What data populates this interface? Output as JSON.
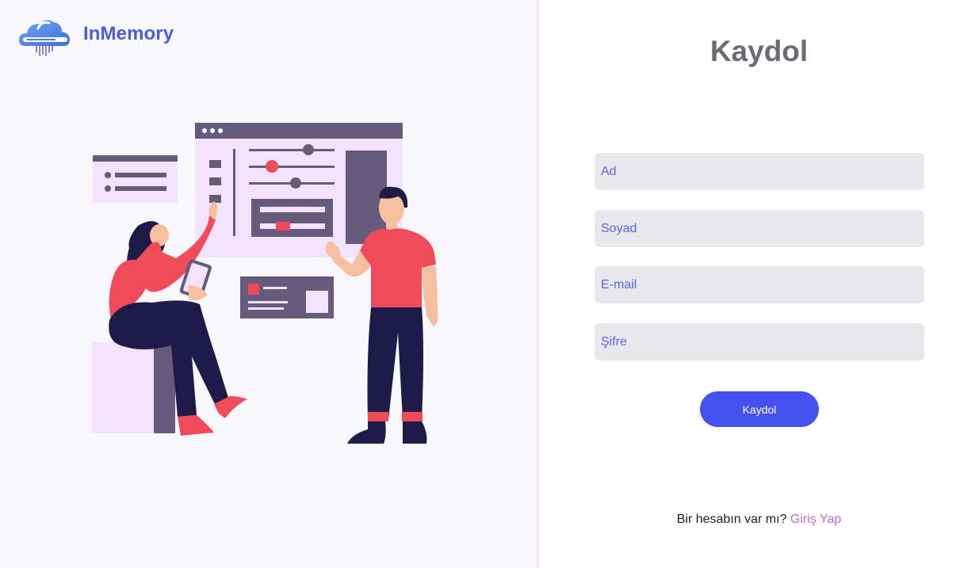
{
  "brand": {
    "name": "InMemory",
    "logo_icon": "cloud-database-icon"
  },
  "illustration": {
    "icon": "team-dashboard-illustration"
  },
  "form": {
    "title": "Kaydol",
    "fields": [
      {
        "placeholder": "Ad",
        "value": ""
      },
      {
        "placeholder": "Soyad",
        "value": ""
      },
      {
        "placeholder": "E-mail",
        "value": ""
      },
      {
        "placeholder": "Şifre",
        "value": ""
      }
    ],
    "submit_label": "Kaydol"
  },
  "footer": {
    "prompt": "Bir hesabın var mı?",
    "link_label": "Giriş Yap"
  },
  "colors": {
    "brand": "#4a5be0",
    "button": "#4451ee",
    "link": "#b36ad0",
    "field_bg": "#e7e7ec",
    "left_bg": "#f8f8fc",
    "accent_red": "#f14a58",
    "accent_purple": "#665a7d"
  }
}
